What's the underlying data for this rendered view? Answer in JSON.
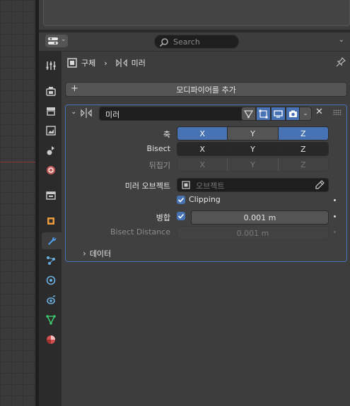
{
  "header": {
    "search_placeholder": "Search",
    "editor_type_icon": "properties-editor-icon",
    "chevron_icon": "chevron-down-icon"
  },
  "breadcrumb": {
    "object_name": "구체",
    "modifier_name": "미러",
    "separator": "›"
  },
  "add_modifier_label": "모디파이어를 추가",
  "modifier": {
    "name": "미러",
    "axis_label": "축",
    "bisect_label": "Bisect",
    "flip_label": "뒤집기",
    "axis_buttons": [
      "X",
      "Y",
      "Z"
    ],
    "axis_state": {
      "x": true,
      "y": false,
      "z": true
    },
    "mirror_object_label": "미러 오브젝트",
    "mirror_object_placeholder": "오브젝트",
    "clipping_label": "Clipping",
    "clipping_checked": true,
    "merge_label": "병합",
    "merge_checked": true,
    "merge_value": "0.001 m",
    "bisect_distance_label": "Bisect Distance",
    "bisect_distance_value": "0.001 m",
    "data_subpanel_label": "데이터"
  },
  "colors": {
    "accent": "#4772b3",
    "panel_bg": "#404040",
    "field_dark": "#1e1e1e",
    "button": "#545454"
  }
}
